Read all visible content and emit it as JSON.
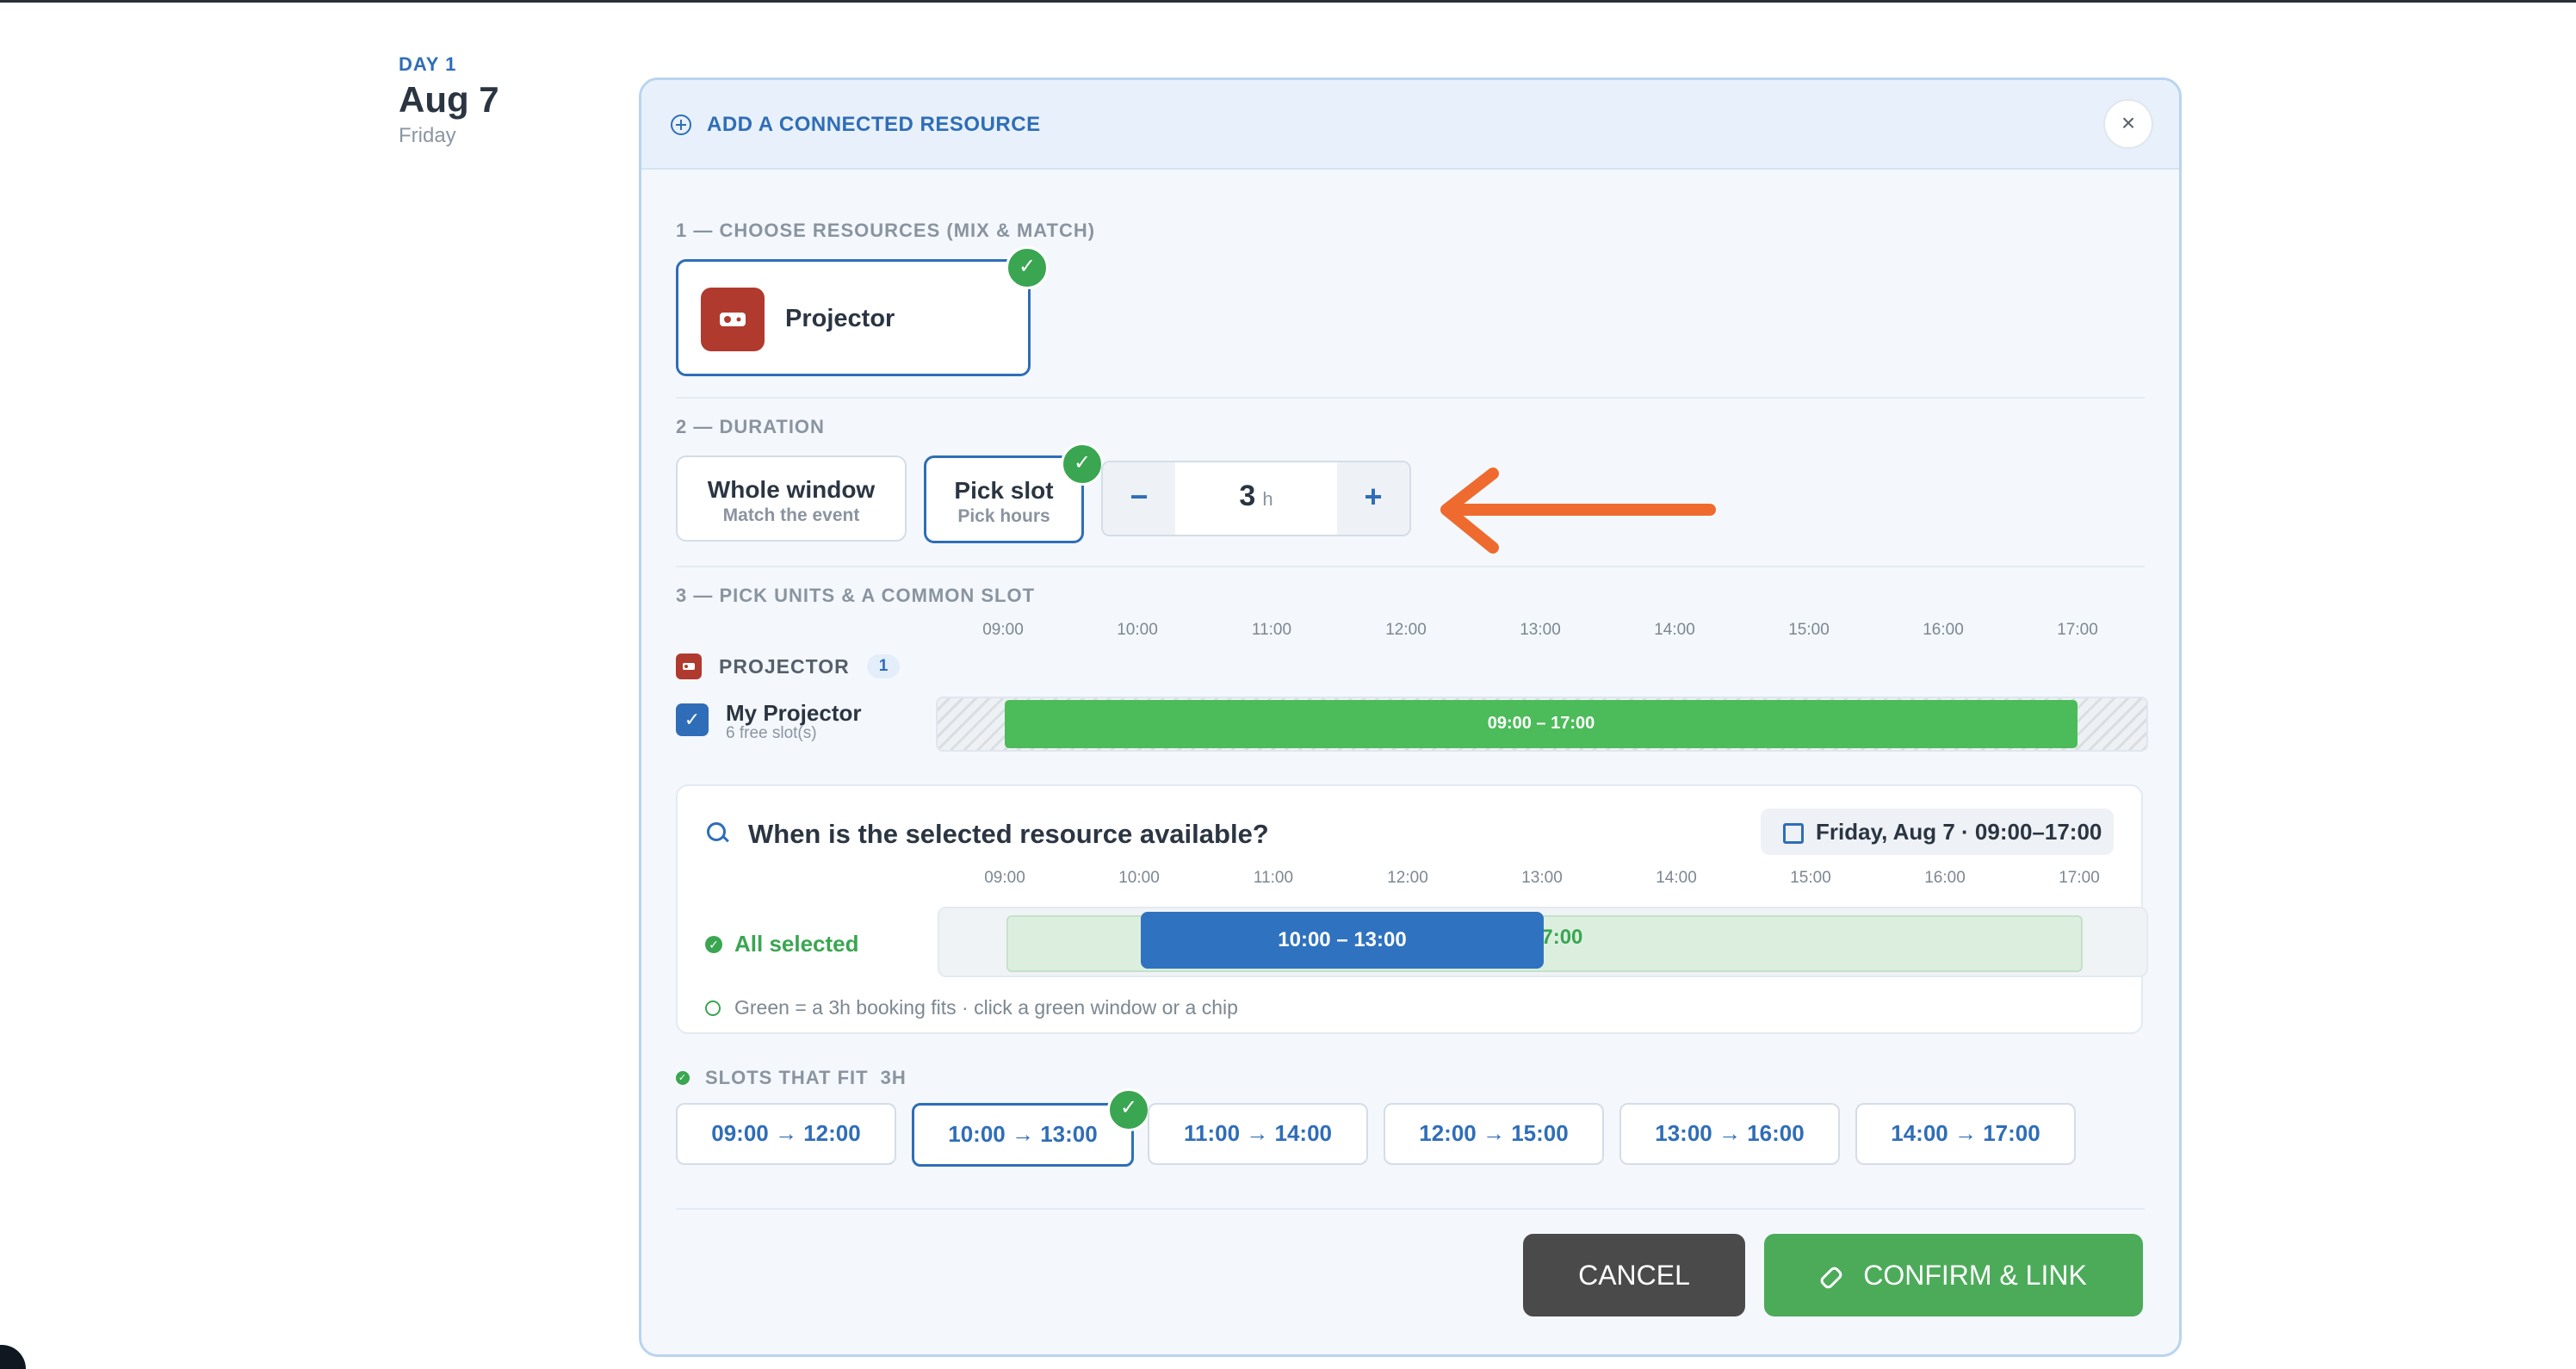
{
  "day": {
    "label": "DAY 1",
    "date": "Aug 7",
    "weekday": "Friday"
  },
  "modal": {
    "title": "ADD A CONNECTED RESOURCE",
    "close_label": "×",
    "step1": {
      "title": "1 — CHOOSE RESOURCES (MIX & MATCH)",
      "resource_name": "Projector"
    },
    "step2": {
      "title": "2 — DURATION",
      "whole_window": {
        "label": "Whole window",
        "sub": "Match the event"
      },
      "pick_slot": {
        "label": "Pick slot",
        "sub": "Pick hours"
      },
      "stepper": {
        "minus": "−",
        "value": "3",
        "unit": "h",
        "plus": "+"
      }
    },
    "step3": {
      "title": "3 — PICK UNITS & A COMMON SLOT",
      "hours": [
        "09:00",
        "10:00",
        "11:00",
        "12:00",
        "13:00",
        "14:00",
        "15:00",
        "16:00",
        "17:00"
      ],
      "group_label": "PROJECTOR",
      "group_count": "1",
      "unit": {
        "name": "My Projector",
        "sub": "6 free slot(s)",
        "window": "09:00 – 17:00"
      }
    },
    "availability": {
      "question": "When is the selected resource available?",
      "date_range": "Friday, Aug 7 · 09:00–17:00",
      "status": "All selected",
      "selected_slot": "10:00 – 13:00",
      "green_label": "17:00",
      "hint": "Green = a 3h booking fits · click a green window or a chip"
    },
    "slots": {
      "title": "SLOTS THAT FIT",
      "duration": "3H",
      "items": [
        "09:00 → 12:00",
        "10:00 → 13:00",
        "11:00 → 14:00",
        "12:00 → 15:00",
        "13:00 → 16:00",
        "14:00 → 17:00"
      ],
      "selected_index": 1
    },
    "actions": {
      "cancel": "CANCEL",
      "confirm": "CONFIRM & LINK"
    }
  },
  "colors": {
    "accent": "#2f6db8",
    "success": "#3aa651",
    "resource": "#b03a2e",
    "annotation_arrow": "#ef6a2e"
  }
}
